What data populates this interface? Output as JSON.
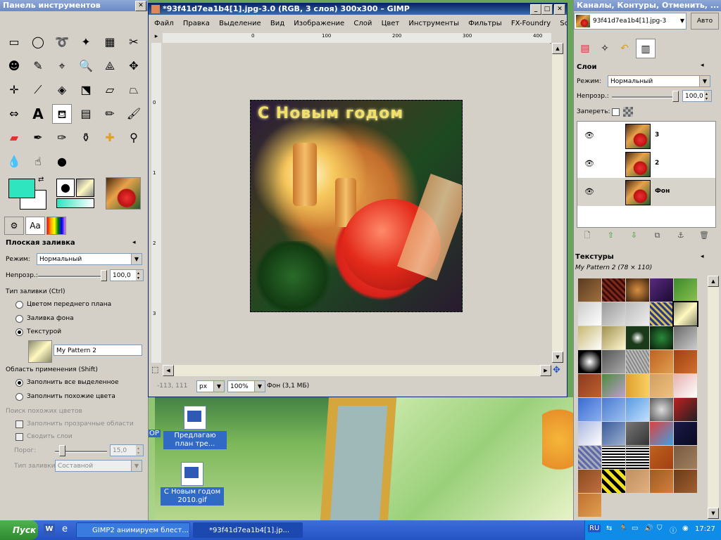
{
  "toolbox": {
    "title": "Панель инструментов",
    "tool_options_title": "Плоская заливка",
    "mode_label": "Режим:",
    "mode_value": "Нормальный",
    "opacity_label": "Непрозр.:",
    "opacity_value": "100,0",
    "fill_type_label": "Тип заливки  (Ctrl)",
    "fill_fg": "Цветом переднего плана",
    "fill_bg": "Заливка фона",
    "fill_pattern": "Текстурой",
    "pattern_name": "My Pattern 2",
    "area_label": "Область применения  (Shift)",
    "area_all": "Заполнить все выделенное",
    "area_similar": "Заполнить похожие цвета",
    "similar_label": "Поиск похожих цветов",
    "transparent_areas": "Заполнить прозрачные области",
    "merge_layers": "Сводить слои",
    "threshold_label": "Порог:",
    "threshold_value": "15,0",
    "fill_by_label": "Тип заливки:",
    "fill_by_value": "Составной",
    "fg_color": "#2ee5c0",
    "bg_color": "#ffffff"
  },
  "image_window": {
    "title": "*93f41d7ea1b4[1].jpg-3.0 (RGB, 3 слоя) 300x300 – GIMP",
    "menu": [
      "Файл",
      "Правка",
      "Выделение",
      "Вид",
      "Изображение",
      "Слой",
      "Цвет",
      "Инструменты",
      "Фильтры",
      "FX-Foundry",
      "Sc"
    ],
    "ruler_h": [
      "0",
      "100",
      "200",
      "300",
      "400"
    ],
    "ruler_v": [
      "0",
      "1",
      "2",
      "3"
    ],
    "art_text": "С Новым годом",
    "status_coords": "-113, 111",
    "status_unit": "px",
    "status_zoom": "100%",
    "status_info": "Фон (3,1 МБ)"
  },
  "dock": {
    "title": "Каналы, Контуры, Отменить, ...",
    "image_select": "93f41d7ea1b4[1].jpg-3",
    "auto_button": "Авто",
    "layers_title": "Слои",
    "mode_label": "Режим:",
    "mode_value": "Нормальный",
    "opacity_label": "Непрозр.:",
    "opacity_value": "100,0",
    "lock_label": "Запереть:",
    "layers": [
      {
        "name": "3"
      },
      {
        "name": "2"
      },
      {
        "name": "Фон"
      }
    ],
    "patterns_title": "Текстуры",
    "pattern_selected": "My Pattern 2 (78 × 110)"
  },
  "desktop": {
    "icon1_label": "Предлагаю план тре...",
    "icon2_label": "С Новым годом 2010.gif",
    "side_label": "OP"
  },
  "taskbar": {
    "start": "Пуск",
    "task1": "GIMP2 анимируем блест...",
    "task2": "*93f41d7ea1b4[1].jp...",
    "lang": "RU",
    "clock": "17:27"
  }
}
